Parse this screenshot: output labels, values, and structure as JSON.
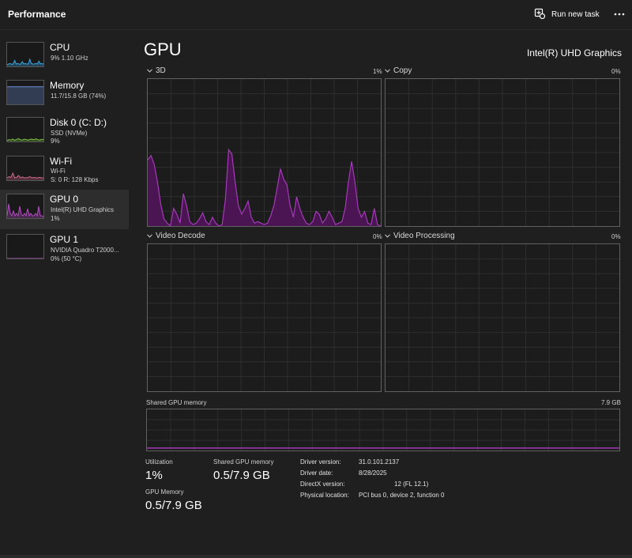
{
  "header": {
    "title": "Performance",
    "run_new_task": "Run new task"
  },
  "sidebar": {
    "items": [
      {
        "name": "CPU",
        "sub1": "9%  1.10 GHz",
        "sub2": "",
        "sub3": "",
        "color": "#3aa8e6",
        "values": [
          0.08,
          0.1,
          0.12,
          0.09,
          0.1,
          0.25,
          0.1,
          0.12,
          0.1,
          0.09,
          0.2,
          0.1,
          0.12,
          0.1,
          0.1,
          0.3,
          0.12,
          0.1,
          0.1,
          0.12,
          0.1,
          0.22,
          0.1,
          0.12,
          0.1
        ]
      },
      {
        "name": "Memory",
        "sub1": "11.7/15.8 GB (74%)",
        "sub2": "",
        "sub3": "",
        "color": "#6e8fd6",
        "values": [
          0.74,
          0.74,
          0.74,
          0.74,
          0.74,
          0.74,
          0.74,
          0.74,
          0.74,
          0.74,
          0.74,
          0.74
        ]
      },
      {
        "name": "Disk 0 (C: D:)",
        "sub1": "SSD (NVMe)",
        "sub2": "9%",
        "sub3": "",
        "color": "#7cc242",
        "values": [
          0.05,
          0.08,
          0.06,
          0.1,
          0.05,
          0.09,
          0.12,
          0.07,
          0.06,
          0.1,
          0.08,
          0.06,
          0.09,
          0.1,
          0.07,
          0.11,
          0.08,
          0.06,
          0.09,
          0.08
        ]
      },
      {
        "name": "Wi-Fi",
        "sub1": "Wi-Fi",
        "sub2": "S: 0  R: 128 Kbps",
        "sub3": "",
        "color": "#d16a8c",
        "values": [
          0.1,
          0.15,
          0.12,
          0.3,
          0.1,
          0.12,
          0.2,
          0.1,
          0.14,
          0.1,
          0.1,
          0.12,
          0.15,
          0.1,
          0.12,
          0.1,
          0.1,
          0.12,
          0.1,
          0.1
        ]
      },
      {
        "name": "GPU 0",
        "sub1": "Intel(R) UHD Graphics",
        "sub2": "1%",
        "sub3": "",
        "color": "#b84bc8",
        "values": [
          0.1,
          0.6,
          0.2,
          0.1,
          0.3,
          0.1,
          0.2,
          0.1,
          0.5,
          0.15,
          0.1,
          0.2,
          0.1,
          0.4,
          0.1,
          0.2,
          0.1,
          0.1,
          0.2,
          0.1,
          0.5,
          0.1,
          0.1,
          0.05
        ]
      },
      {
        "name": "GPU 1",
        "sub1": "NVIDIA Quadro T2000...",
        "sub2": "0%  (50 °C)",
        "sub3": "",
        "color": "#b84bc8",
        "values": [
          0,
          0,
          0,
          0,
          0,
          0,
          0,
          0,
          0,
          0
        ]
      }
    ]
  },
  "main": {
    "title": "GPU",
    "adapter": "Intel(R) UHD Graphics",
    "graphs": [
      {
        "label": "3D",
        "pct": "1%"
      },
      {
        "label": "Copy",
        "pct": "0%"
      },
      {
        "label": "Video Decode",
        "pct": "0%"
      },
      {
        "label": "Video Processing",
        "pct": "0%"
      }
    ],
    "shared_mem_label": "Shared GPU memory",
    "shared_mem_max": "7.9 GB"
  },
  "graph_3d_values": [
    0.45,
    0.48,
    0.42,
    0.3,
    0.15,
    0.05,
    0.02,
    0.0,
    0.12,
    0.08,
    0.02,
    0.22,
    0.14,
    0.03,
    0.01,
    0.02,
    0.05,
    0.09,
    0.03,
    0.01,
    0.06,
    0.02,
    0.0,
    0.01,
    0.18,
    0.52,
    0.49,
    0.3,
    0.14,
    0.08,
    0.12,
    0.17,
    0.06,
    0.02,
    0.03,
    0.02,
    0.01,
    0.02,
    0.07,
    0.14,
    0.26,
    0.39,
    0.32,
    0.28,
    0.14,
    0.06,
    0.2,
    0.12,
    0.06,
    0.02,
    0.01,
    0.03,
    0.1,
    0.08,
    0.02,
    0.05,
    0.1,
    0.06,
    0.01,
    0.02,
    0.03,
    0.12,
    0.3,
    0.44,
    0.3,
    0.12,
    0.06,
    0.1,
    0.02,
    0.01,
    0.12,
    0.01,
    0.0
  ],
  "stats": {
    "utilization_label": "Utilization",
    "utilization_value": "1%",
    "shared_label": "Shared GPU memory",
    "shared_value": "0.5/7.9 GB",
    "gpu_mem_label": "GPU Memory",
    "gpu_mem_value": "0.5/7.9 GB"
  },
  "info": [
    {
      "key": "Driver version:",
      "value": "31.0.101.2137"
    },
    {
      "key": "Driver date:",
      "value": "8/28/2025"
    },
    {
      "key": "DirectX version:",
      "value": "12 (FL 12.1)"
    },
    {
      "key": "Physical location:",
      "value": "PCI bus 0, device 2, function 0"
    }
  ],
  "colors": {
    "gpu_line": "#a43ab8",
    "gpu_fill": "#4a1552",
    "grid": "#2e2e2e",
    "border": "#616161"
  }
}
